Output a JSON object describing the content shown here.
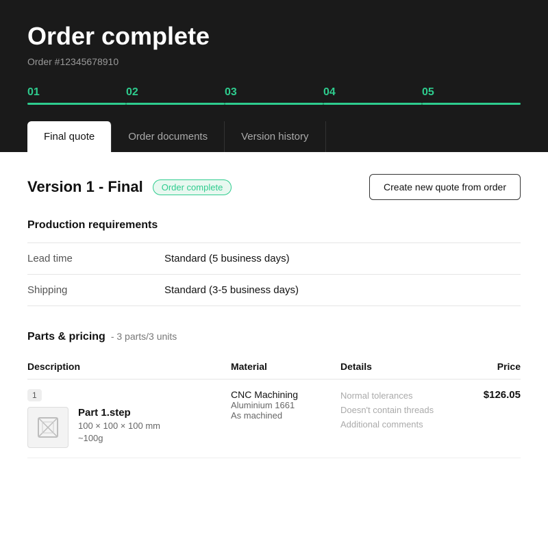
{
  "header": {
    "title": "Order complete",
    "order_number": "Order #12345678910"
  },
  "progress": {
    "steps": [
      "01",
      "02",
      "03",
      "04",
      "05"
    ]
  },
  "tabs": [
    {
      "label": "Final quote",
      "active": true
    },
    {
      "label": "Order documents",
      "active": false
    },
    {
      "label": "Version history",
      "active": false
    }
  ],
  "version": {
    "title": "Version 1 - Final",
    "status": "Order complete",
    "create_quote_btn": "Create new quote from order"
  },
  "production": {
    "section_title": "Production requirements",
    "rows": [
      {
        "label": "Lead time",
        "value": "Standard (5 business days)"
      },
      {
        "label": "Shipping",
        "value": "Standard (3-5 business days)"
      }
    ]
  },
  "parts": {
    "section_title": "Parts & pricing",
    "subtitle": "- 3 parts/3 units",
    "columns": [
      "Description",
      "Material",
      "Details",
      "Price"
    ],
    "items": [
      {
        "row_num": "1",
        "name": "Part 1.step",
        "dimensions": "100 × 100 × 100 mm",
        "weight": "~100g",
        "material": "CNC Machining",
        "material_grade": "Aluminium 1661",
        "finish": "As machined",
        "details": [
          "Normal tolerances",
          "Doesn't contain threads",
          "Additional comments"
        ],
        "price": "$126.05"
      }
    ]
  }
}
